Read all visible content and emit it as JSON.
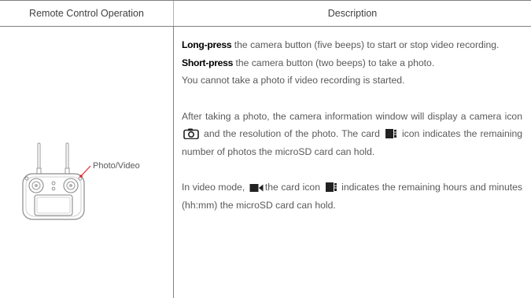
{
  "header": {
    "col1": "Remote Control Operation",
    "col2": "Description"
  },
  "left": {
    "callout_label": "Photo/Video",
    "image_icon": "remote-controller-illustration",
    "pointer_color": "#e8252c"
  },
  "description": {
    "p1_bold": "Long-press",
    "p1_text": " the camera button (five beeps) to start or stop video recording.",
    "p2_bold": "Short-press",
    "p2_text": " the camera button (two beeps) to take a photo.",
    "p3_text": "You cannot take a photo if video recording is started.",
    "p4_a": "After taking a photo, the camera information window will display a camera icon ",
    "p4_b": " and the resolution of the photo.  The card ",
    "p4_c": " icon indicates the remaining number of photos the microSD card can hold.",
    "p5_a": "In video mode, ",
    "p5_b": "the card icon ",
    "p5_c": " indicates the remaining hours and minutes (hh:mm) the microSD card can hold.",
    "icons": {
      "camera": "camera-icon",
      "card": "sd-card-icon",
      "video": "video-camera-icon"
    }
  },
  "colors": {
    "strong_text": "#000000",
    "body_text": "#595959",
    "rule": "#808080"
  }
}
